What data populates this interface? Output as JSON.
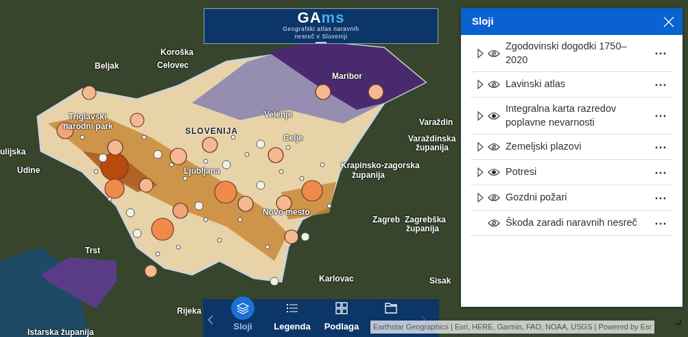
{
  "header": {
    "logo_prefix": "GA",
    "logo_suffix": "ms",
    "subtitle_lines": [
      "Geografski atlas naravnih",
      "nesreč v Sloveniji"
    ]
  },
  "map": {
    "labels": [
      {
        "text": "Koroška",
        "kind": "region"
      },
      {
        "text": "Beljak",
        "kind": "city"
      },
      {
        "text": "Celovec",
        "kind": "city"
      },
      {
        "text": "Maribor",
        "kind": "city"
      },
      {
        "text": "Triglavski",
        "kind": "region"
      },
      {
        "text": "narodni park",
        "kind": "region"
      },
      {
        "text": "SLOVENIJA",
        "kind": "country"
      },
      {
        "text": "Velenje",
        "kind": "city"
      },
      {
        "text": "Celje",
        "kind": "city"
      },
      {
        "text": "Varaždin",
        "kind": "city"
      },
      {
        "text": "Varaždinska",
        "kind": "region"
      },
      {
        "text": "županija",
        "kind": "region"
      },
      {
        "text": "ulijska",
        "kind": "region"
      },
      {
        "text": "Udine",
        "kind": "city"
      },
      {
        "text": "Ljubljana",
        "kind": "city"
      },
      {
        "text": "Krapinsko-zagorska",
        "kind": "region"
      },
      {
        "text": "županija",
        "kind": "region"
      },
      {
        "text": "Novo mesto",
        "kind": "city"
      },
      {
        "text": "Zagreb",
        "kind": "city"
      },
      {
        "text": "Zagrebška",
        "kind": "region"
      },
      {
        "text": "županija",
        "kind": "region"
      },
      {
        "text": "Trst",
        "kind": "city"
      },
      {
        "text": "Karlovac",
        "kind": "city"
      },
      {
        "text": "Sisak",
        "kind": "city"
      },
      {
        "text": "Rijeka",
        "kind": "city"
      },
      {
        "text": "Istarska županija",
        "kind": "region"
      }
    ],
    "attribution": "Earthstar Geographics | Esri, HERE, Garmin, FAO, NOAA, USGS | Powered by Esr"
  },
  "bottom_bar": {
    "tabs": [
      {
        "label": "Sloji",
        "selected": true
      },
      {
        "label": "Legenda",
        "selected": false
      },
      {
        "label": "Podlaga",
        "selected": false
      },
      {
        "selected": false
      }
    ]
  },
  "panel": {
    "title": "Sloji",
    "layers": [
      {
        "name": "Zgodovinski dogodki 1750–2020",
        "expandable": true,
        "visible": false
      },
      {
        "name": "Lavinski atlas",
        "expandable": true,
        "visible": false
      },
      {
        "name": "Integralna karta razredov poplavne nevarnosti",
        "expandable": true,
        "visible": true
      },
      {
        "name": "Zemeljski plazovi",
        "expandable": true,
        "visible": false
      },
      {
        "name": "Potresi",
        "expandable": true,
        "visible": true
      },
      {
        "name": "Gozdni požari",
        "expandable": true,
        "visible": false
      },
      {
        "name": "Škoda zaradi naravnih nesreč",
        "expandable": false,
        "visible": false
      }
    ]
  }
}
